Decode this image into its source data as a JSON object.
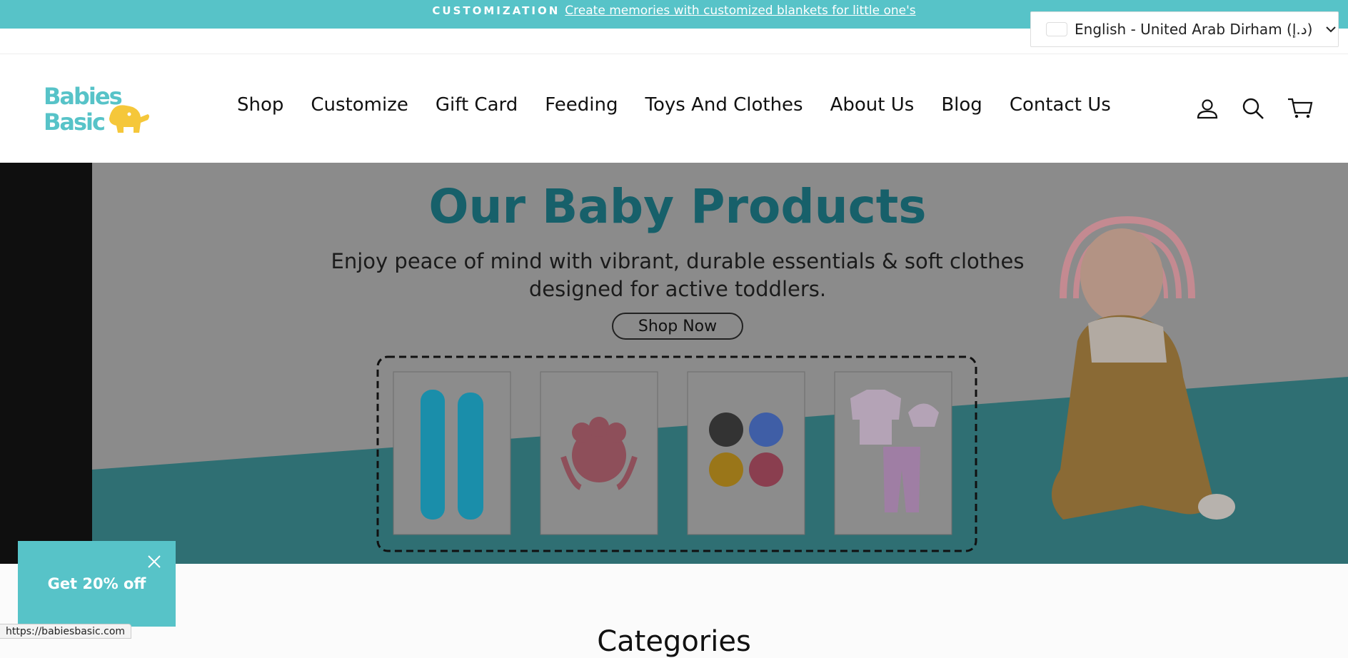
{
  "announcement": {
    "label": "CUSTOMIZATION",
    "link_text": "Create memories with customized blankets for little one's"
  },
  "locale_selector": {
    "value": "English - United Arab Dirham (د.إ)"
  },
  "logo": {
    "line1": "Babies",
    "line2": "Basic"
  },
  "nav": {
    "items": [
      "Shop",
      "Customize",
      "Gift Card",
      "Feeding",
      "Toys And Clothes",
      "About Us",
      "Blog",
      "Contact Us"
    ]
  },
  "header_icons": [
    "account-icon",
    "search-icon",
    "cart-icon"
  ],
  "hero": {
    "title": "Our Baby Products",
    "subtitle_line1": "Enjoy peace of mind with vibrant, durable essentials & soft clothes",
    "subtitle_line2": "designed for active toddlers.",
    "cta": "Shop Now"
  },
  "popup": {
    "text": "Get 20% off"
  },
  "status_bar": {
    "url": "https://babiesbasic.com"
  },
  "section": {
    "heading": "Categories"
  },
  "colors": {
    "brand_teal": "#57c3c8",
    "logo_yellow": "#f5c73a",
    "hero_teal": "#16707a"
  }
}
